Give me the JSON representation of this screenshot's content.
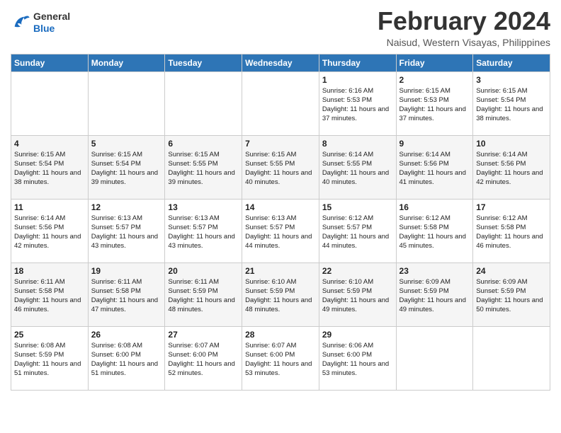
{
  "header": {
    "logo_line1": "General",
    "logo_line2": "Blue",
    "month_title": "February 2024",
    "location": "Naisud, Western Visayas, Philippines"
  },
  "days_of_week": [
    "Sunday",
    "Monday",
    "Tuesday",
    "Wednesday",
    "Thursday",
    "Friday",
    "Saturday"
  ],
  "weeks": [
    [
      {
        "num": "",
        "sunrise": "",
        "sunset": "",
        "daylight": ""
      },
      {
        "num": "",
        "sunrise": "",
        "sunset": "",
        "daylight": ""
      },
      {
        "num": "",
        "sunrise": "",
        "sunset": "",
        "daylight": ""
      },
      {
        "num": "",
        "sunrise": "",
        "sunset": "",
        "daylight": ""
      },
      {
        "num": "1",
        "sunrise": "6:16 AM",
        "sunset": "5:53 PM",
        "daylight": "11 hours and 37 minutes."
      },
      {
        "num": "2",
        "sunrise": "6:15 AM",
        "sunset": "5:53 PM",
        "daylight": "11 hours and 37 minutes."
      },
      {
        "num": "3",
        "sunrise": "6:15 AM",
        "sunset": "5:54 PM",
        "daylight": "11 hours and 38 minutes."
      }
    ],
    [
      {
        "num": "4",
        "sunrise": "6:15 AM",
        "sunset": "5:54 PM",
        "daylight": "11 hours and 38 minutes."
      },
      {
        "num": "5",
        "sunrise": "6:15 AM",
        "sunset": "5:54 PM",
        "daylight": "11 hours and 39 minutes."
      },
      {
        "num": "6",
        "sunrise": "6:15 AM",
        "sunset": "5:55 PM",
        "daylight": "11 hours and 39 minutes."
      },
      {
        "num": "7",
        "sunrise": "6:15 AM",
        "sunset": "5:55 PM",
        "daylight": "11 hours and 40 minutes."
      },
      {
        "num": "8",
        "sunrise": "6:14 AM",
        "sunset": "5:55 PM",
        "daylight": "11 hours and 40 minutes."
      },
      {
        "num": "9",
        "sunrise": "6:14 AM",
        "sunset": "5:56 PM",
        "daylight": "11 hours and 41 minutes."
      },
      {
        "num": "10",
        "sunrise": "6:14 AM",
        "sunset": "5:56 PM",
        "daylight": "11 hours and 42 minutes."
      }
    ],
    [
      {
        "num": "11",
        "sunrise": "6:14 AM",
        "sunset": "5:56 PM",
        "daylight": "11 hours and 42 minutes."
      },
      {
        "num": "12",
        "sunrise": "6:13 AM",
        "sunset": "5:57 PM",
        "daylight": "11 hours and 43 minutes."
      },
      {
        "num": "13",
        "sunrise": "6:13 AM",
        "sunset": "5:57 PM",
        "daylight": "11 hours and 43 minutes."
      },
      {
        "num": "14",
        "sunrise": "6:13 AM",
        "sunset": "5:57 PM",
        "daylight": "11 hours and 44 minutes."
      },
      {
        "num": "15",
        "sunrise": "6:12 AM",
        "sunset": "5:57 PM",
        "daylight": "11 hours and 44 minutes."
      },
      {
        "num": "16",
        "sunrise": "6:12 AM",
        "sunset": "5:58 PM",
        "daylight": "11 hours and 45 minutes."
      },
      {
        "num": "17",
        "sunrise": "6:12 AM",
        "sunset": "5:58 PM",
        "daylight": "11 hours and 46 minutes."
      }
    ],
    [
      {
        "num": "18",
        "sunrise": "6:11 AM",
        "sunset": "5:58 PM",
        "daylight": "11 hours and 46 minutes."
      },
      {
        "num": "19",
        "sunrise": "6:11 AM",
        "sunset": "5:58 PM",
        "daylight": "11 hours and 47 minutes."
      },
      {
        "num": "20",
        "sunrise": "6:11 AM",
        "sunset": "5:59 PM",
        "daylight": "11 hours and 48 minutes."
      },
      {
        "num": "21",
        "sunrise": "6:10 AM",
        "sunset": "5:59 PM",
        "daylight": "11 hours and 48 minutes."
      },
      {
        "num": "22",
        "sunrise": "6:10 AM",
        "sunset": "5:59 PM",
        "daylight": "11 hours and 49 minutes."
      },
      {
        "num": "23",
        "sunrise": "6:09 AM",
        "sunset": "5:59 PM",
        "daylight": "11 hours and 49 minutes."
      },
      {
        "num": "24",
        "sunrise": "6:09 AM",
        "sunset": "5:59 PM",
        "daylight": "11 hours and 50 minutes."
      }
    ],
    [
      {
        "num": "25",
        "sunrise": "6:08 AM",
        "sunset": "5:59 PM",
        "daylight": "11 hours and 51 minutes."
      },
      {
        "num": "26",
        "sunrise": "6:08 AM",
        "sunset": "6:00 PM",
        "daylight": "11 hours and 51 minutes."
      },
      {
        "num": "27",
        "sunrise": "6:07 AM",
        "sunset": "6:00 PM",
        "daylight": "11 hours and 52 minutes."
      },
      {
        "num": "28",
        "sunrise": "6:07 AM",
        "sunset": "6:00 PM",
        "daylight": "11 hours and 53 minutes."
      },
      {
        "num": "29",
        "sunrise": "6:06 AM",
        "sunset": "6:00 PM",
        "daylight": "11 hours and 53 minutes."
      },
      {
        "num": "",
        "sunrise": "",
        "sunset": "",
        "daylight": ""
      },
      {
        "num": "",
        "sunrise": "",
        "sunset": "",
        "daylight": ""
      }
    ]
  ],
  "labels": {
    "sunrise_prefix": "Sunrise: ",
    "sunset_prefix": "Sunset: ",
    "daylight_prefix": "Daylight: "
  }
}
